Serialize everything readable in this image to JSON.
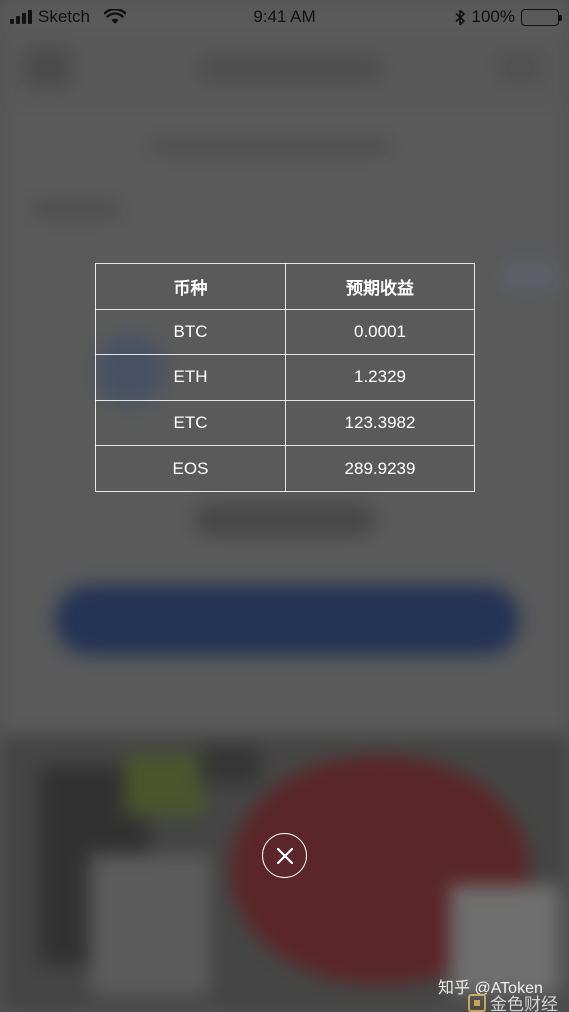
{
  "status_bar": {
    "carrier": "Sketch",
    "time": "9:41 AM",
    "battery": "100%"
  },
  "yield_table": {
    "headers": [
      "币种",
      "预期收益"
    ],
    "rows": [
      {
        "coin": "BTC",
        "yield": "0.0001"
      },
      {
        "coin": "ETH",
        "yield": "1.2329"
      },
      {
        "coin": "ETC",
        "yield": "123.3982"
      },
      {
        "coin": "EOS",
        "yield": "289.9239"
      }
    ]
  },
  "watermark": {
    "zhihu": "知乎 @AToken",
    "brand": "金色财经"
  },
  "colors": {
    "background_button": "#183063",
    "overlay": "#5f5f5f",
    "text": "#ffffff"
  }
}
